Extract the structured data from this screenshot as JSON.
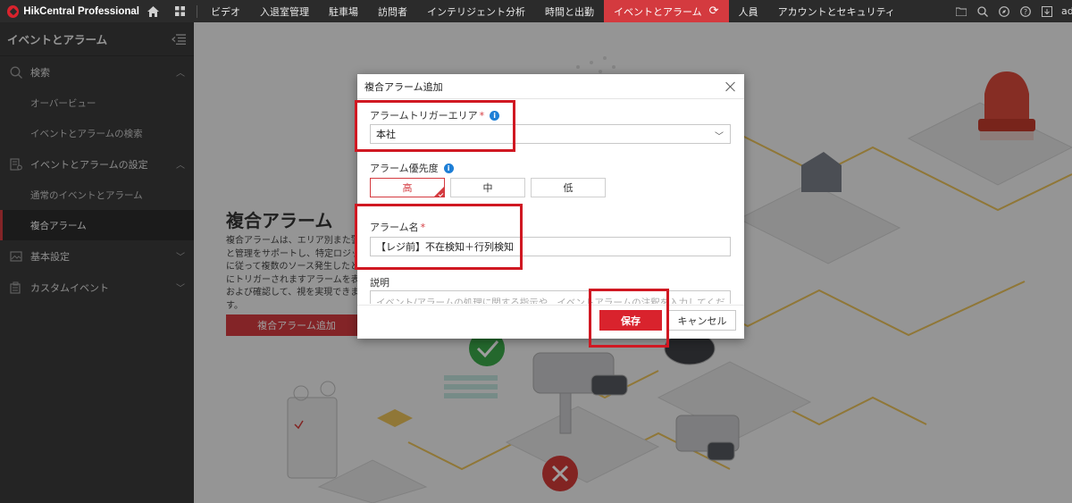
{
  "app": {
    "brand": "HikCentral Professional",
    "user_truncated": "ad"
  },
  "top_nav": [
    {
      "label": "ビデオ",
      "active": false
    },
    {
      "label": "入退室管理",
      "active": false
    },
    {
      "label": "駐車場",
      "active": false
    },
    {
      "label": "訪問者",
      "active": false
    },
    {
      "label": "インテリジェント分析",
      "active": false
    },
    {
      "label": "時間と出勤",
      "active": false
    },
    {
      "label": "イベントとアラーム",
      "active": true
    },
    {
      "label": "人員",
      "active": false
    },
    {
      "label": "アカウントとセキュリティ",
      "active": false
    }
  ],
  "sidebar": {
    "title": "イベントとアラーム",
    "groups": [
      {
        "label": "検索",
        "icon": "search-icon"
      },
      {
        "label": "イベントとアラームの設定",
        "icon": "settings-doc-icon"
      },
      {
        "label": "基本設定",
        "icon": "image-settings-icon"
      },
      {
        "label": "カスタムイベント",
        "icon": "custom-event-icon"
      }
    ],
    "subitems": {
      "overview": "オーバービュー",
      "search_events": "イベントとアラームの検索",
      "normal_events": "通常のイベントとアラーム",
      "composite_alarm": "複合アラーム"
    }
  },
  "main": {
    "title": "複合アラーム",
    "description": "複合アラームは、エリア別また警戒と管理をサポートし、特定ロジックに従って複数のソース発生したときにトリガーされますアラームを表示および確認して、視を実現できます。",
    "add_button": "複合アラーム追加"
  },
  "dialog": {
    "title": "複合アラーム追加",
    "trigger_area": {
      "label": "アラームトリガーエリア",
      "required": "*",
      "value": "本社"
    },
    "priority": {
      "label": "アラーム優先度",
      "options": [
        "高",
        "中",
        "低"
      ],
      "selected": "高"
    },
    "alarm_name": {
      "label": "アラーム名",
      "required": "*",
      "value": "【レジ前】不在検知＋行列検知"
    },
    "description": {
      "label": "説明",
      "placeholder": "イベント/アラームの処理に関する指示や、イベントアラームの注釈を入力してくだ"
    },
    "save": "保存",
    "cancel": "キャンセル"
  },
  "colors": {
    "accent": "#d43a3f",
    "highlight": "#d01822",
    "topbar": "#2b2b2b",
    "sidebar": "#3a3a3a"
  }
}
